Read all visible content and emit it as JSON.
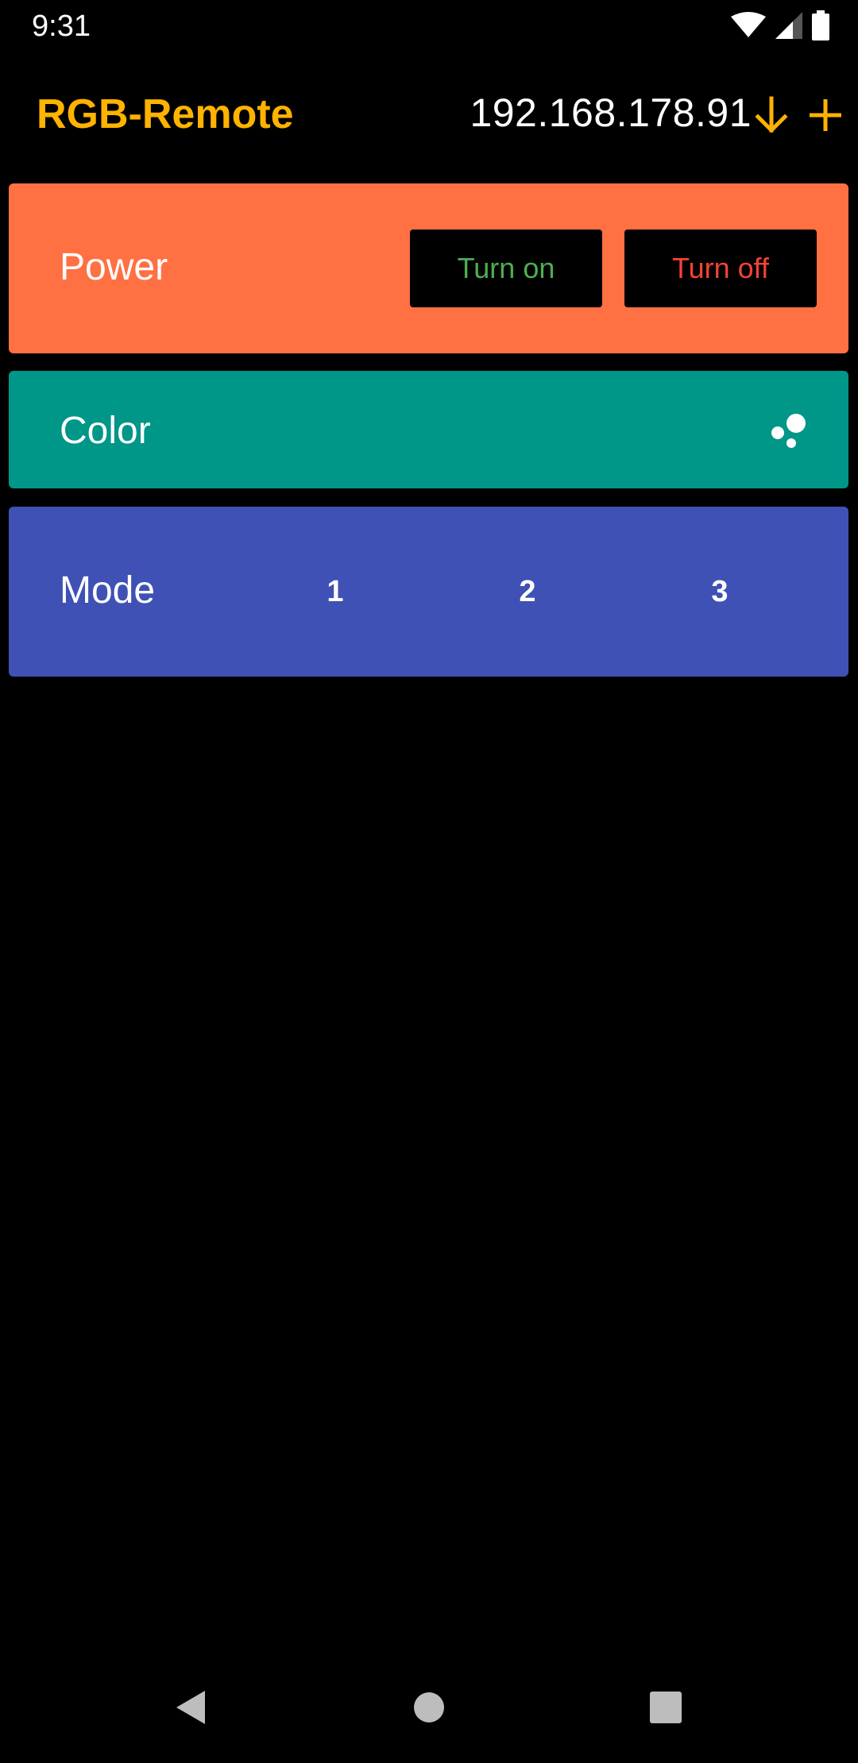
{
  "status_bar": {
    "time": "9:31",
    "icons": [
      "wifi-icon",
      "cell-signal-icon",
      "battery-icon"
    ]
  },
  "app_bar": {
    "title": "RGB-Remote",
    "ip_address": "192.168.178.91",
    "actions": [
      "arrow-down-icon",
      "add-icon"
    ]
  },
  "power_card": {
    "label": "Power",
    "turn_on_label": "Turn on",
    "turn_off_label": "Turn off"
  },
  "color_card": {
    "label": "Color",
    "icon": "bubbles-icon"
  },
  "mode_card": {
    "label": "Mode",
    "modes": [
      "1",
      "2",
      "3"
    ]
  },
  "nav_bar": {
    "buttons": [
      "back-icon",
      "home-icon",
      "recents-icon"
    ]
  },
  "colors": {
    "accent": "#FFB300",
    "power": "#FF7043",
    "color": "#009688",
    "mode": "#3F51B5",
    "on": "#4CAF50",
    "off": "#F44336"
  }
}
